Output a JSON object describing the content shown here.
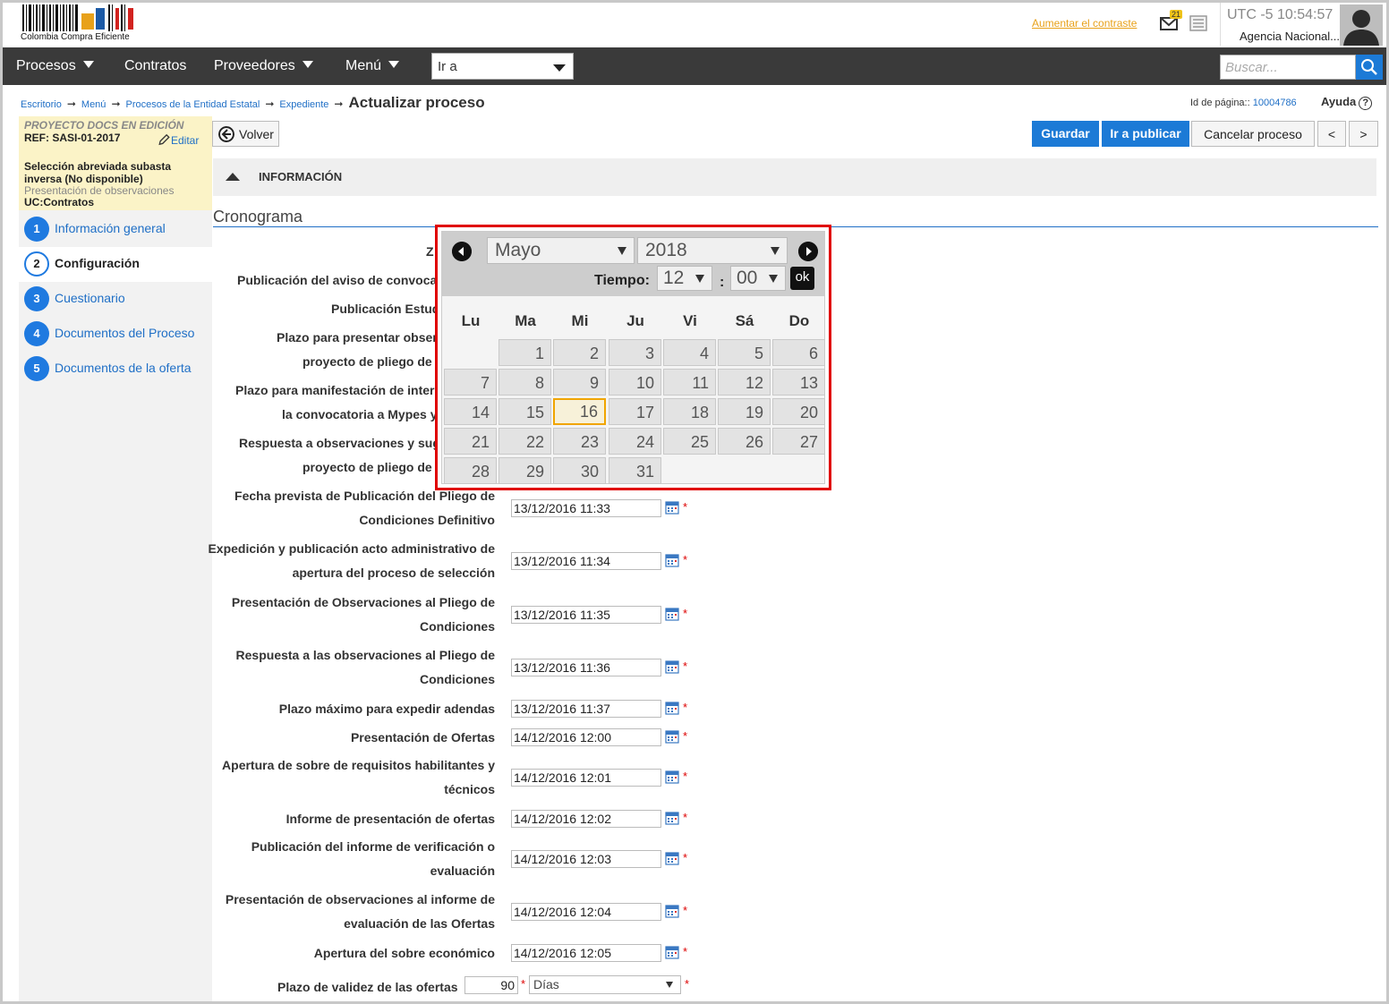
{
  "header": {
    "logo_text": "Colombia Compra Eficiente",
    "contrast_link": "Aumentar el contraste",
    "mail_badge": "21",
    "utc_time": "UTC -5 10:54:57",
    "agency": "Agencia Nacional..."
  },
  "nav": {
    "items": [
      "Procesos",
      "Contratos",
      "Proveedores",
      "Menú"
    ],
    "goto_label": "Ir a",
    "search_placeholder": "Buscar..."
  },
  "breadcrumb": {
    "items": [
      "Escritorio",
      "Menú",
      "Procesos de la Entidad Estatal",
      "Expediente"
    ],
    "current": "Actualizar proceso"
  },
  "page_id": {
    "label": "Id de página::",
    "value": "10004786"
  },
  "help_label": "Ayuda",
  "project": {
    "title": "PROYECTO DOCS EN EDICIÓN",
    "ref": "REF: SASI-01-2017",
    "edit_label": "Editar",
    "modality": "Selección abreviada subasta inversa (No disponible)",
    "phase": "Presentación de observaciones",
    "uc": "UC:Contratos"
  },
  "steps": [
    {
      "num": "1",
      "label": "Información general"
    },
    {
      "num": "2",
      "label": "Configuración"
    },
    {
      "num": "3",
      "label": "Cuestionario"
    },
    {
      "num": "4",
      "label": "Documentos del Proceso"
    },
    {
      "num": "5",
      "label": "Documentos de la oferta"
    }
  ],
  "actions": {
    "back": "Volver",
    "save": "Guardar",
    "publish": "Ir a publicar",
    "cancel": "Cancelar proceso",
    "prev": "<",
    "next": ">"
  },
  "section_title": "INFORMACIÓN",
  "schedule_title": "Cronograma",
  "hidden_labels": [
    [
      "Z"
    ],
    [
      "Publicación del aviso de convocat"
    ],
    [
      "Publicación Estud"
    ],
    [
      "Plazo para presentar obser",
      "proyecto de pliego de c"
    ],
    [
      "Plazo para manifestación de interé",
      "la convocatoria a Mypes y"
    ],
    [
      "Respuesta a observaciones y sug",
      "proyecto de pliego de c"
    ]
  ],
  "schedule": [
    {
      "label": [
        "Fecha prevista de Publicación del Pliego de",
        "Condiciones Definitivo"
      ],
      "value": "13/12/2016 11:33"
    },
    {
      "label": [
        "Expedición y publicación acto administrativo de",
        "apertura del proceso de selección"
      ],
      "value": "13/12/2016 11:34"
    },
    {
      "label": [
        "Presentación de Observaciones al Pliego de",
        "Condiciones"
      ],
      "value": "13/12/2016 11:35"
    },
    {
      "label": [
        "Respuesta a las observaciones al Pliego de",
        "Condiciones"
      ],
      "value": "13/12/2016 11:36"
    },
    {
      "label": [
        "Plazo máximo para expedir adendas"
      ],
      "value": "13/12/2016 11:37"
    },
    {
      "label": [
        "Presentación de Ofertas"
      ],
      "value": "14/12/2016 12:00"
    },
    {
      "label": [
        "Apertura de sobre de requisitos habilitantes y",
        "técnicos"
      ],
      "value": "14/12/2016 12:01"
    },
    {
      "label": [
        "Informe de presentación de ofertas"
      ],
      "value": "14/12/2016 12:02"
    },
    {
      "label": [
        "Publicación del informe de verificación o",
        "evaluación"
      ],
      "value": "14/12/2016 12:03"
    },
    {
      "label": [
        "Presentación de observaciones al informe de",
        "evaluación de las Ofertas"
      ],
      "value": "14/12/2016 12:04"
    },
    {
      "label": [
        "Apertura del sobre económico"
      ],
      "value": "14/12/2016 12:05"
    }
  ],
  "validity": {
    "label": "Plazo de validez de las ofertas",
    "value": "90",
    "unit": "Días"
  },
  "required_mark": "*",
  "calendar": {
    "month": "Mayo",
    "year": "2018",
    "time_label": "Tiempo:",
    "hour": "12",
    "colon": ":",
    "minute": "00",
    "ok_label": "ok",
    "weekdays": [
      "Lu",
      "Ma",
      "Mi",
      "Ju",
      "Vi",
      "Sá",
      "Do"
    ],
    "first_weekday_index": 1,
    "days_in_month": 31,
    "today": 16
  },
  "colors": {
    "nav_bg": "#3a3a3a",
    "primary_blue": "#1c7ad6",
    "link_blue": "#1f6fc6",
    "highlight_red": "#e00000",
    "today_border": "#f0a500"
  }
}
